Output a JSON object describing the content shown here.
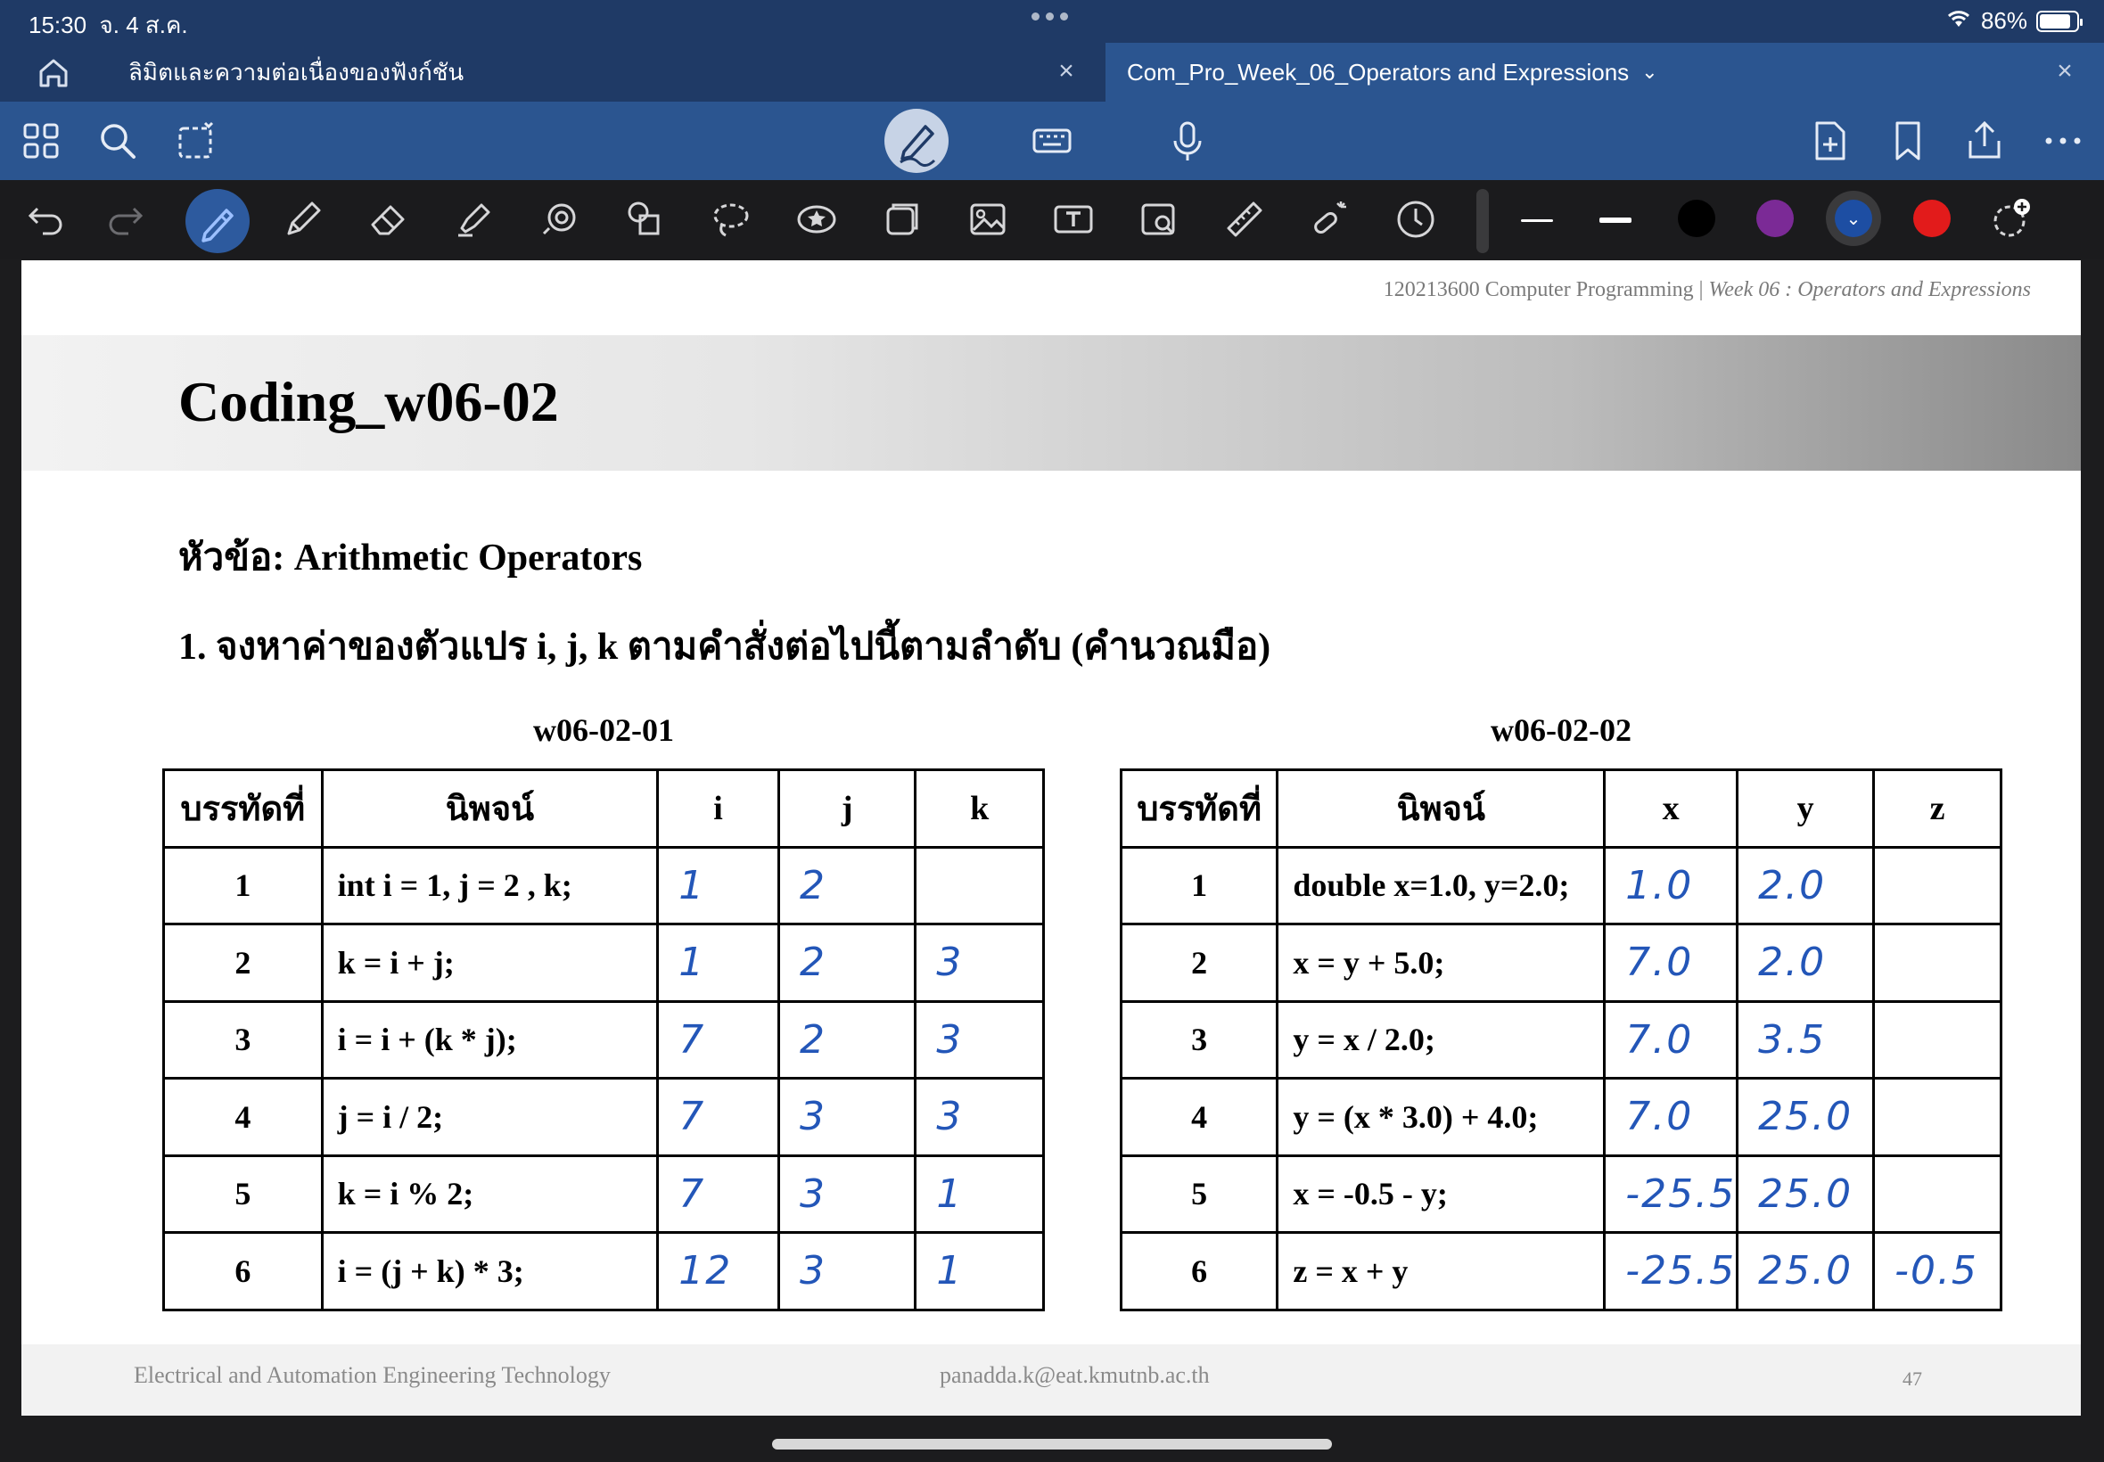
{
  "status": {
    "time": "15:30",
    "date": "จ. 4 ส.ค.",
    "battery": "86%",
    "battery_level": 0.86
  },
  "tabs": [
    {
      "label": "ลิมิตและความต่อเนื่องของฟังก์ชัน"
    },
    {
      "label": "Com_Pro_Week_06_Operators and Expressions"
    }
  ],
  "toolbar_icons": [
    "grid-icon",
    "search-icon",
    "select-icon",
    "pen-mode-icon",
    "keyboard-icon",
    "microphone-icon",
    "add-page-icon",
    "bookmark-icon",
    "share-icon",
    "more-icon"
  ],
  "tools": [
    "undo-icon",
    "redo-icon",
    "pen-icon",
    "pencil-icon",
    "eraser-icon",
    "highlighter-icon",
    "shape-icon",
    "shapes-icon",
    "lasso-icon",
    "sticker-icon",
    "note-icon",
    "image-icon",
    "textbox-icon",
    "camera-icon",
    "ruler-icon",
    "laser-pointer-icon",
    "timer-icon"
  ],
  "colors": {
    "black": "#000000",
    "purple": "#7b2a96",
    "blue": "#1d4ea3",
    "red": "#e21b1b"
  },
  "page": {
    "header_course": "120213600 Computer Programming | ",
    "header_week": "Week 06 : Operators and Expressions",
    "title": "Coding_w06-02",
    "topic": "หัวข้อ: Arithmetic Operators",
    "question": "1. จงหาค่าของตัวแปร i, j, k ตามคำสั่งต่อไปนี้ตามลำดับ (คำนวณมือ)",
    "footer_left": "Electrical and Automation Engineering Technology",
    "footer_email": "panadda.k@eat.kmutnb.ac.th",
    "page_number": "47"
  },
  "table1": {
    "caption": "w06-02-01",
    "headers": [
      "บรรทัดที่",
      "นิพจน์",
      "i",
      "j",
      "k"
    ],
    "rows": [
      [
        "1",
        "int i = 1, j = 2 , k;",
        "1",
        "2",
        ""
      ],
      [
        "2",
        "k = i + j;",
        "1",
        "2",
        "3"
      ],
      [
        "3",
        "i = i + (k * j);",
        "7",
        "2",
        "3"
      ],
      [
        "4",
        "j = i / 2;",
        "7",
        "3",
        "3"
      ],
      [
        "5",
        "k = i % 2;",
        "7",
        "3",
        "1"
      ],
      [
        "6",
        "i = (j + k) * 3;",
        "12",
        "3",
        "1"
      ]
    ]
  },
  "table2": {
    "caption": "w06-02-02",
    "headers": [
      "บรรทัดที่",
      "นิพจน์",
      "x",
      "y",
      "z"
    ],
    "rows": [
      [
        "1",
        "double x=1.0, y=2.0;",
        "1.0",
        "2.0",
        ""
      ],
      [
        "2",
        "x = y + 5.0;",
        "7.0",
        "2.0",
        ""
      ],
      [
        "3",
        "y = x / 2.0;",
        "7.0",
        "3.5",
        ""
      ],
      [
        "4",
        "y = (x * 3.0) + 4.0;",
        "7.0",
        "25.0",
        ""
      ],
      [
        "5",
        "x = -0.5 - y;",
        "-25.5",
        "25.0",
        ""
      ],
      [
        "6",
        "z = x + y",
        "-25.5",
        "25.0",
        "-0.5"
      ]
    ]
  }
}
